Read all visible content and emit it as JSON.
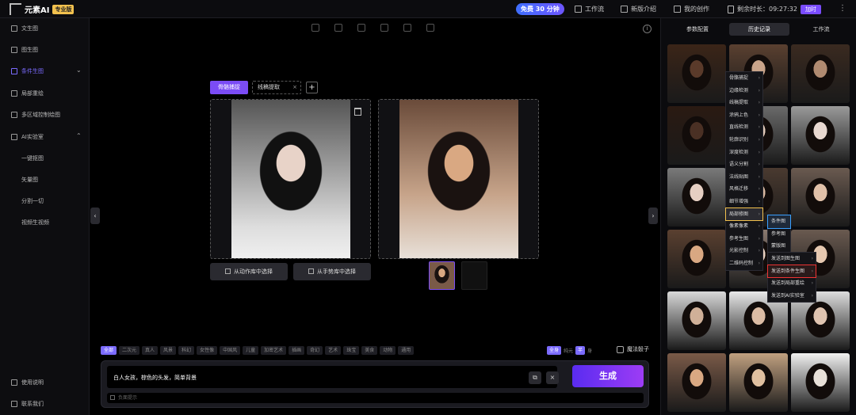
{
  "header": {
    "logo_text": "元素AI",
    "logo_sub": "专业版",
    "free_badge": "免费 30 分钟",
    "nav": [
      {
        "label": "工作流",
        "icon": "workflow-icon"
      },
      {
        "label": "新版介绍",
        "icon": "new-version-icon"
      },
      {
        "label": "我的创作",
        "icon": "image-icon"
      }
    ],
    "remaining_label": "剩余时长：09:27:32",
    "topup_label": "加时",
    "more": "⋮"
  },
  "sidebar": {
    "items": [
      {
        "label": "文生图",
        "icon": "text-to-image-icon"
      },
      {
        "label": "图生图",
        "icon": "image-to-image-icon"
      },
      {
        "label": "条件生图",
        "icon": "condition-icon"
      },
      {
        "label": "局部重绘",
        "icon": "inpaint-icon"
      },
      {
        "label": "多区域控制绘图",
        "icon": "multi-region-icon"
      },
      {
        "label": "AI实验室",
        "icon": "lab-icon"
      }
    ],
    "lab_sub": [
      "一键抠图",
      "矢量图",
      "分割一切",
      "视频生视频"
    ],
    "bottom": [
      {
        "label": "使用说明",
        "icon": "manual-icon"
      },
      {
        "label": "联系我们",
        "icon": "contact-icon"
      }
    ]
  },
  "canvas": {
    "tab_active": "骨骼捕捉",
    "tab2": "线稿提取",
    "tab2_close": "×",
    "add": "+",
    "btn_action_lib": "从动作库中选择",
    "btn_hand_lib": "从手势库中选择"
  },
  "tags": [
    "全部",
    "二次元",
    "真人",
    "风景",
    "科幻",
    "女性像",
    "中国风",
    "儿童",
    "加密艺术",
    "插画",
    "奇幻",
    "艺术",
    "珠宝",
    "美食",
    "动物",
    "通用"
  ],
  "right_tags": {
    "all": "全身",
    "full_label": "纯元",
    "half": "半",
    "half_label": "身"
  },
  "dice_label": "魔法骰子",
  "prompt": {
    "text": "白人女孩，棕色的头发，简单背景",
    "copy": "⧉",
    "clear": "×",
    "generate": "生成",
    "negative_placeholder": "负面提示"
  },
  "right_panel": {
    "tabs": [
      "参数配置",
      "历史记录",
      "工作流"
    ]
  },
  "context_menu": {
    "main": [
      "骨骼捕捉",
      "边缘检测",
      "线稿提取",
      "涂鸦上色",
      "直线检测",
      "轮廓识别",
      "深度检测",
      "语义分割",
      "法线贴图",
      "风格迁移",
      "细节增强",
      "局部修图",
      "像素像素",
      "参考生图",
      "光影控制",
      "二维码控制"
    ],
    "sub1": [
      "条件图",
      "参考图",
      "蒙版图"
    ],
    "sub2": [
      "发送到图生图",
      "发送到条件生图",
      "发送到局部重绘",
      "发送到AI实验室"
    ]
  },
  "colors": {
    "accent": "#7b4cf5",
    "badge": "#f2c14e",
    "highlight_red": "#e33333",
    "highlight_blue": "#3aa0ff"
  }
}
